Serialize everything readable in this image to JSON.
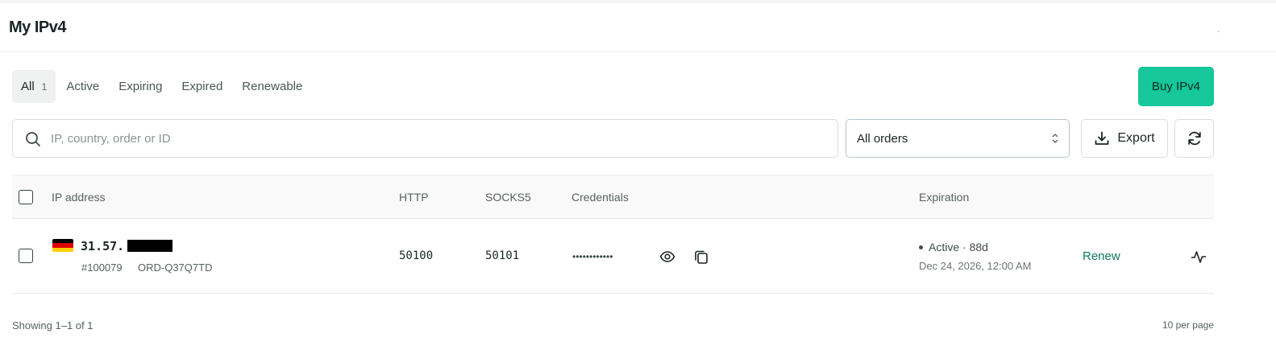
{
  "header": {
    "title": "My IPv4",
    "corner_mark": "-"
  },
  "tabs": [
    {
      "label": "All",
      "count": "1"
    },
    {
      "label": "Active"
    },
    {
      "label": "Expiring"
    },
    {
      "label": "Expired"
    },
    {
      "label": "Renewable"
    }
  ],
  "toolbar": {
    "buy_label": "Buy IPv4",
    "search_placeholder": "IP, country, order or ID",
    "filter_selected": "All orders",
    "export_label": "Export"
  },
  "table": {
    "columns": [
      "IP address",
      "HTTP",
      "SOCKS5",
      "Credentials",
      "Expiration"
    ],
    "rows": [
      {
        "country_flag": "germany-flag",
        "ip_visible": "31.57.",
        "order_id": "#100079",
        "order_ref": "ORD-Q37Q7TD",
        "http": "50100",
        "socks5": "50101",
        "credentials_masked": "••••••••••••",
        "status": "Active · 88d",
        "expiration_date": "Dec 24, 2026, 12:00 AM",
        "action_label": "Renew"
      }
    ]
  },
  "footer": {
    "showing": "Showing 1–1 of 1",
    "per_page": "10 per page"
  },
  "colors": {
    "accent": "#16c79a",
    "renew_text": "#0e7a5c"
  },
  "icons": [
    "search-icon",
    "chevron-updown-icon",
    "download-icon",
    "refresh-icon",
    "eye-icon",
    "copy-icon",
    "activity-icon"
  ]
}
